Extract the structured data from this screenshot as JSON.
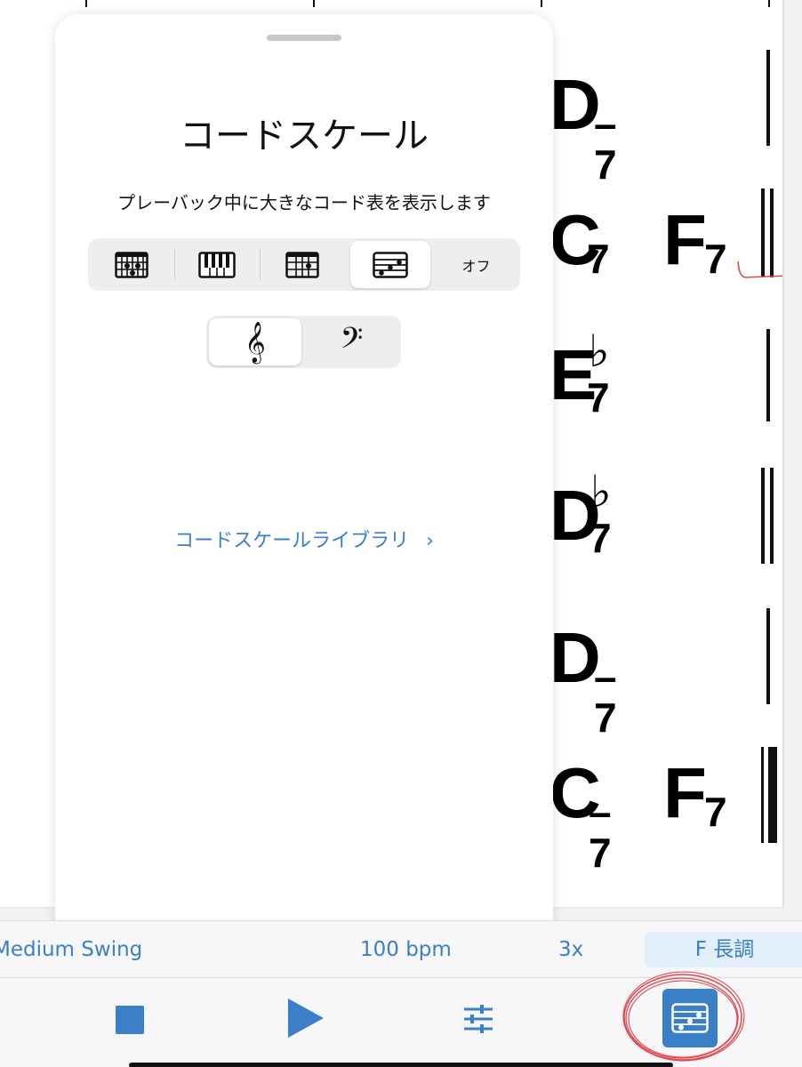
{
  "sheet": {
    "chords": [
      {
        "root": "D",
        "quality": "–7",
        "accidental": ""
      },
      {
        "root": "C",
        "quality": "7",
        "accidental": ""
      },
      {
        "root": "F",
        "quality": "7",
        "accidental": ""
      },
      {
        "root": "E",
        "quality": "7",
        "accidental": "♭"
      },
      {
        "root": "D",
        "quality": "7",
        "accidental": "♭"
      },
      {
        "root": "D",
        "quality": "–7",
        "accidental": ""
      },
      {
        "root": "C",
        "quality": "–7",
        "accidental": ""
      },
      {
        "root": "F",
        "quality": "7",
        "accidental": ""
      }
    ]
  },
  "modal": {
    "title": "コードスケール",
    "subtitle": "プレーバック中に大きなコード表を表示します",
    "display_options": [
      {
        "icon": "guitar-fretboard-icon",
        "selected": false
      },
      {
        "icon": "piano-keyboard-icon",
        "selected": false
      },
      {
        "icon": "ukulele-fretboard-icon",
        "selected": false
      },
      {
        "icon": "chord-scale-icon",
        "selected": true
      },
      {
        "label": "オフ",
        "selected": false
      }
    ],
    "clef_options": [
      {
        "icon": "treble-clef-icon",
        "selected": true
      },
      {
        "icon": "bass-clef-icon",
        "selected": false
      }
    ],
    "library_link": "コードスケールライブラリ"
  },
  "info_bar": {
    "style": "Medium Swing",
    "tempo": "100 bpm",
    "repeats": "3x",
    "key": "F 長調"
  },
  "toolbar": {
    "icons": [
      "stop-icon",
      "play-icon",
      "mixer-sliders-icon",
      "chord-scale-icon"
    ]
  },
  "colors": {
    "accent": "#3b7fc9",
    "annotation": "#e0474c"
  }
}
